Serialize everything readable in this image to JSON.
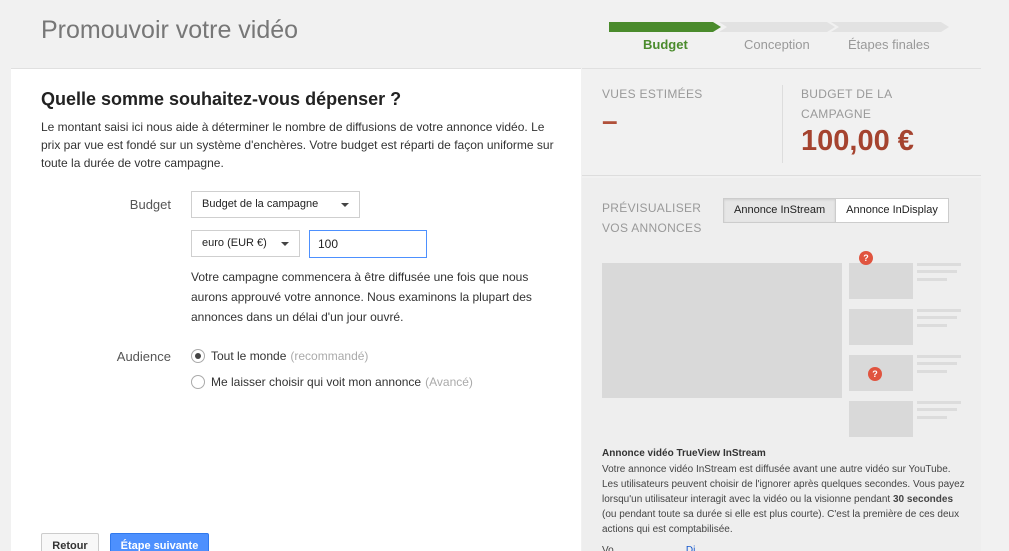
{
  "header": {
    "title": "Promouvoir votre vidéo",
    "steps": [
      {
        "label": "Budget",
        "active": true
      },
      {
        "label": "Conception",
        "active": false
      },
      {
        "label": "Étapes finales",
        "active": false
      }
    ]
  },
  "main": {
    "heading": "Quelle somme souhaitez-vous dépenser ?",
    "description": "Le montant saisi ici nous aide à déterminer le nombre de diffusions de votre annonce vidéo. Le prix par vue est fondé sur un système d'enchères. Votre budget est réparti de façon uniforme sur toute la durée de votre campagne.",
    "budget_label": "Budget",
    "budget_type_selected": "Budget de la campagne",
    "currency_selected": "euro (EUR €)",
    "amount_value": "100",
    "help_text": "Votre campagne commencera à être diffusée une fois que nous aurons approuvé votre annonce. Nous examinons la plupart des annonces dans un délai d'un jour ouvré.",
    "audience_label": "Audience",
    "audience_options": [
      {
        "label": "Tout le monde",
        "hint": "(recommandé)",
        "checked": true
      },
      {
        "label": "Me laisser choisir qui voit mon annonce",
        "hint": "(Avancé)",
        "checked": false
      }
    ],
    "back_button": "Retour",
    "next_button": "Étape suivante"
  },
  "summary": {
    "views_label": "VUES ESTIMÉES",
    "views_value": "–",
    "budget_label_line1": "BUDGET DE LA",
    "budget_label_line2": "CAMPAGNE",
    "budget_value": "100,00 €"
  },
  "preview": {
    "label_line1": "PRÉVISUALISER",
    "label_line2": "VOS ANNONCES",
    "tabs": [
      {
        "label": "Annonce InStream",
        "active": true
      },
      {
        "label": "Annonce InDisplay",
        "active": false
      }
    ],
    "badge": "?",
    "ad_title": "Annonce vidéo TrueView InStream",
    "ad_desc_before": "Votre annonce vidéo InStream est diffusée avant une autre vidéo sur YouTube. Les utilisateurs peuvent choisir de l'ignorer après quelques secondes. Vous payez lorsqu'un utilisateur interagit avec la vidéo ou la visionne pendant ",
    "ad_desc_bold": "30 secondes",
    "ad_desc_after": " (ou pendant toute sa durée si elle est plus courte). C'est la première de ces deux actions qui est comptabilisée.",
    "more_text": "Vo                          ",
    "more_link": "Di"
  },
  "colors": {
    "accent_green": "#4a8b2c",
    "budget_red": "#a5432f",
    "primary_blue": "#4d90fe",
    "badge_red": "#e0543f"
  }
}
